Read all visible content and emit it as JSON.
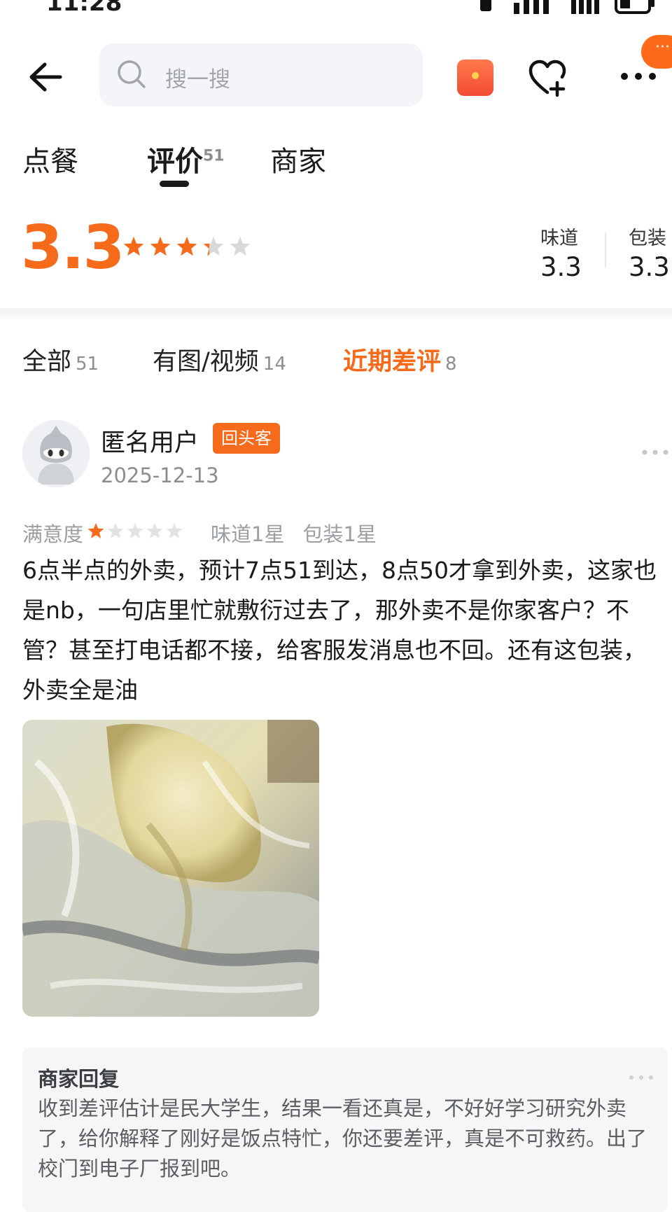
{
  "status_bar": {
    "time": "11:28"
  },
  "header": {
    "search_placeholder": "搜一搜",
    "icons": [
      "back-arrow-icon",
      "search-icon",
      "red-packet-icon",
      "favorite-heart-icon",
      "more-dots-icon"
    ]
  },
  "tabs": [
    {
      "label": "点餐",
      "badge": ""
    },
    {
      "label": "评价",
      "badge": "51",
      "active": true
    },
    {
      "label": "商家",
      "badge": ""
    }
  ],
  "rating": {
    "overall": "3.3",
    "stars_value": 3.3,
    "stars_max": 5,
    "sub": [
      {
        "label": "味道",
        "value": "3.3"
      },
      {
        "label": "包装",
        "value": "3.3"
      }
    ]
  },
  "filters": [
    {
      "label": "全部",
      "count": "51"
    },
    {
      "label": "有图/视频",
      "count": "14"
    },
    {
      "label": "近期差评",
      "count": "8",
      "active": true
    }
  ],
  "review": {
    "username": "匿名用户",
    "badge": "回头客",
    "date": "2025-12-13",
    "satisfaction_label": "满意度",
    "satisfaction_stars": 1,
    "taste": "味道1星",
    "package": "包装1星",
    "text": "6点半点的外卖，预计7点51到达，8点50才拿到外卖，这家也是nb，一句店里忙就敷衍过去了，那外卖不是你家客户？不管？甚至打电话都不接，给客服发消息也不回。还有这包装，外卖全是油"
  },
  "merchant_reply": {
    "title": "商家回复",
    "text": "收到差评估计是民大学生，结果一看还真是，不好好学习研究外卖了，给你解释了刚好是饭点特忙，你还要差评，真是不可救药。出了校门到电子厂报到吧。"
  },
  "colors": {
    "accent": "#f56a1b",
    "star_on": "#f56a1b",
    "star_off": "#d9d9d9"
  }
}
